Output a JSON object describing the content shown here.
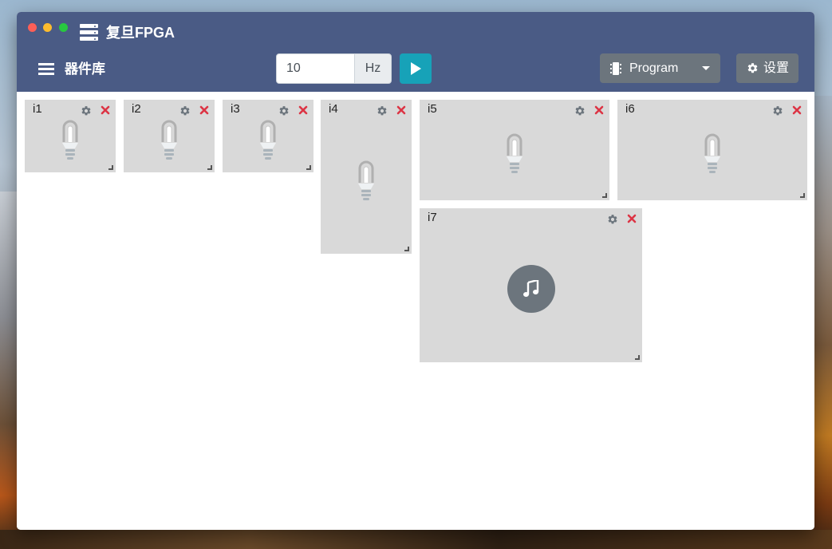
{
  "window": {
    "title": "复旦FPGA"
  },
  "toolbar": {
    "library_label": "器件库",
    "frequency": {
      "value": "10",
      "unit": "Hz"
    },
    "program_label": "Program",
    "settings_label": "设置"
  },
  "colors": {
    "titlebar": "#4a5b85",
    "play": "#17a2b8",
    "button_gray": "#6c757d",
    "widget_bg": "#d9d9d9",
    "close_red": "#dc3545"
  },
  "widgets": [
    {
      "label": "i1",
      "type": "bulb"
    },
    {
      "label": "i2",
      "type": "bulb"
    },
    {
      "label": "i3",
      "type": "bulb"
    },
    {
      "label": "i4",
      "type": "bulb"
    },
    {
      "label": "i5",
      "type": "bulb"
    },
    {
      "label": "i6",
      "type": "bulb"
    },
    {
      "label": "i7",
      "type": "buzzer",
      "icon": "music-note-icon"
    }
  ]
}
